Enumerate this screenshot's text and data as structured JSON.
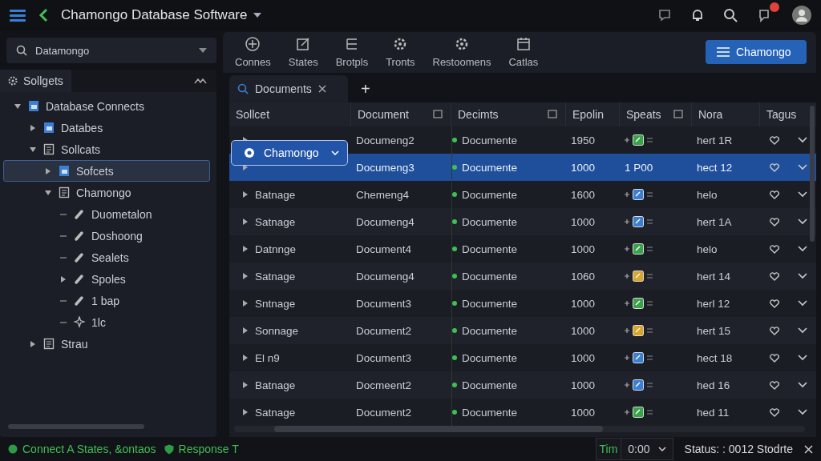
{
  "window": {
    "title": "Chamongo Database Software"
  },
  "search": {
    "value": "Datamongo"
  },
  "sidebar": {
    "title": "Sollgets",
    "items": [
      {
        "label": "Database Connects",
        "kind": "db",
        "expanded": true,
        "selected": false,
        "children": [
          {
            "label": "Databes",
            "kind": "db",
            "expanded": false,
            "selected": false
          },
          {
            "label": "Sollcats",
            "kind": "doc",
            "expanded": true,
            "selected": false,
            "children": [
              {
                "label": "Sofcets",
                "kind": "db",
                "expanded": false,
                "selected": true
              },
              {
                "label": "Chamongo",
                "kind": "doc",
                "expanded": true,
                "selected": false,
                "children": [
                  {
                    "label": "Duometalon",
                    "kind": "plug",
                    "selected": false
                  },
                  {
                    "label": "Doshoong",
                    "kind": "plug",
                    "selected": false
                  },
                  {
                    "label": "Sealets",
                    "kind": "plug",
                    "selected": false
                  },
                  {
                    "label": "Spoles",
                    "kind": "plug",
                    "expanded": false,
                    "selected": false
                  },
                  {
                    "label": "1 bap",
                    "kind": "plug",
                    "selected": false
                  },
                  {
                    "label": "1lc",
                    "kind": "spark",
                    "selected": false
                  }
                ]
              }
            ]
          },
          {
            "label": "Strau",
            "kind": "doc",
            "expanded": false,
            "selected": false
          }
        ]
      }
    ]
  },
  "toolbar": [
    {
      "label": "Connes",
      "kind": "plus"
    },
    {
      "label": "States",
      "kind": "edit"
    },
    {
      "label": "Brotpls",
      "kind": "list"
    },
    {
      "label": "Tronts",
      "kind": "gear"
    },
    {
      "label": "Restoomens",
      "kind": "gear"
    },
    {
      "label": "Catlas",
      "kind": "cal"
    }
  ],
  "primary_button": {
    "label": "Chamongo"
  },
  "tabs": [
    {
      "label": "Documents",
      "selected": true
    }
  ],
  "new_tab": "+",
  "table": {
    "columns": [
      {
        "label": "Sollcet",
        "menu": false
      },
      {
        "label": "Document",
        "menu": true
      },
      {
        "label": "Decimts",
        "menu": true
      },
      {
        "label": "Epolin",
        "menu": false
      },
      {
        "label": "Speats",
        "menu": true
      },
      {
        "label": "Nora",
        "menu": false
      },
      {
        "label": "Tagus",
        "menu": false
      }
    ],
    "rows": [
      {
        "name": "",
        "document": "Documeng2",
        "decimts": "Documente",
        "epolin": "1950",
        "speats": {
          "kind": "icon",
          "color": "#3aa24a"
        },
        "nora": "hert 1R",
        "selected": false
      },
      {
        "name": "",
        "document": "Documeng3",
        "decimts": "Documente",
        "epolin": "1000",
        "speats": {
          "kind": "text",
          "text": "1 P00"
        },
        "nora": "hect 12",
        "selected": true
      },
      {
        "name": "Batnage",
        "document": "Chemeng4",
        "decimts": "Documente",
        "epolin": "1600",
        "speats": {
          "kind": "icon",
          "color": "#3b7fd4"
        },
        "nora": "helo",
        "selected": false
      },
      {
        "name": "Satnage",
        "document": "Documeng4",
        "decimts": "Documente",
        "epolin": "1000",
        "speats": {
          "kind": "icon",
          "color": "#3b7fd4"
        },
        "nora": "hert 1A",
        "selected": false
      },
      {
        "name": "Datnnge",
        "document": "Document4",
        "decimts": "Documente",
        "epolin": "1000",
        "speats": {
          "kind": "icon",
          "color": "#3aa24a"
        },
        "nora": "helo",
        "selected": false
      },
      {
        "name": "Satnage",
        "document": "Documeng4",
        "decimts": "Documente",
        "epolin": "1060",
        "speats": {
          "kind": "icon",
          "color": "#d9a52a"
        },
        "nora": "hert 14",
        "selected": false
      },
      {
        "name": "Sntnage",
        "document": "Document3",
        "decimts": "Documente",
        "epolin": "1000",
        "speats": {
          "kind": "icon",
          "color": "#3aa24a"
        },
        "nora": "herl 12",
        "selected": false
      },
      {
        "name": "Sonnage",
        "document": "Document2",
        "decimts": "Documente",
        "epolin": "1000",
        "speats": {
          "kind": "icon",
          "color": "#d9a52a"
        },
        "nora": "hert 15",
        "selected": false
      },
      {
        "name": "El n9",
        "document": "Document3",
        "decimts": "Documente",
        "epolin": "1000",
        "speats": {
          "kind": "icon",
          "color": "#3b7fd4"
        },
        "nora": "hect 18",
        "selected": false
      },
      {
        "name": "Batnage",
        "document": "Docmeent2",
        "decimts": "Documente",
        "epolin": "1000",
        "speats": {
          "kind": "icon",
          "color": "#3b7fd4"
        },
        "nora": "hed 16",
        "selected": false
      },
      {
        "name": "Satnage",
        "document": "Document2",
        "decimts": "Documente",
        "epolin": "1000",
        "speats": {
          "kind": "icon",
          "color": "#3aa24a"
        },
        "nora": "hed 11",
        "selected": false
      }
    ]
  },
  "row_dropdown": {
    "label": "Chamongo"
  },
  "status_bar": {
    "left": "Connect A States, &ontaos",
    "response": "Response T",
    "time_label": "Tim",
    "time_value": "0:00",
    "status": "Status: : 0012 Stodrte"
  }
}
